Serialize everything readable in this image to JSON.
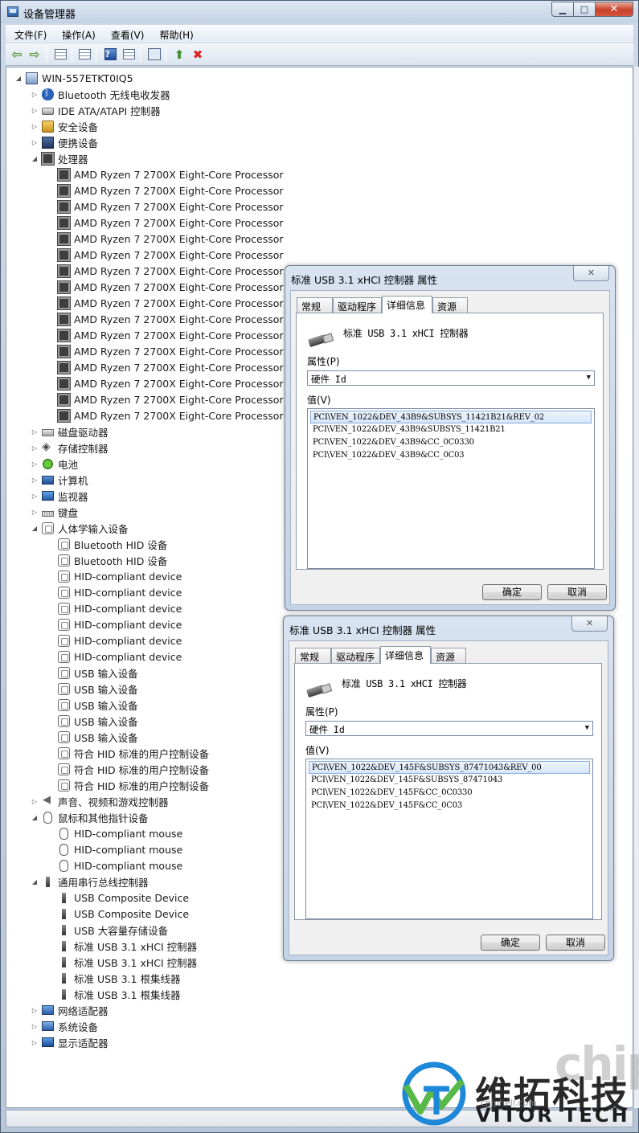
{
  "window": {
    "title": "设备管理器"
  },
  "menu": [
    "文件(F)",
    "操作(A)",
    "查看(V)",
    "帮助(H)"
  ],
  "toolbar": {
    "icons": [
      "back-arrow-icon",
      "forward-arrow-icon",
      "show-hide-tree-icon",
      "properties-icon",
      "help-icon",
      "details-view-icon",
      "scan-hardware-icon",
      "update-driver-icon",
      "uninstall-icon"
    ]
  },
  "tree": {
    "root": "WIN-557ETKT0IQ5",
    "rows": [
      {
        "level": 1,
        "expand": "▷",
        "icon": "bt",
        "label": "Bluetooth 无线电收发器"
      },
      {
        "level": 1,
        "expand": "▷",
        "icon": "drive",
        "label": "IDE ATA/ATAPI 控制器"
      },
      {
        "level": 1,
        "expand": "▷",
        "icon": "key",
        "label": "安全设备"
      },
      {
        "level": 1,
        "expand": "▷",
        "icon": "portable",
        "label": "便携设备"
      },
      {
        "level": 1,
        "expand": "◢",
        "icon": "cpu",
        "label": "处理器"
      },
      {
        "level": 2,
        "expand": "",
        "icon": "cpu",
        "label": "AMD Ryzen 7 2700X Eight-Core Processor"
      },
      {
        "level": 2,
        "expand": "",
        "icon": "cpu",
        "label": "AMD Ryzen 7 2700X Eight-Core Processor"
      },
      {
        "level": 2,
        "expand": "",
        "icon": "cpu",
        "label": "AMD Ryzen 7 2700X Eight-Core Processor"
      },
      {
        "level": 2,
        "expand": "",
        "icon": "cpu",
        "label": "AMD Ryzen 7 2700X Eight-Core Processor"
      },
      {
        "level": 2,
        "expand": "",
        "icon": "cpu",
        "label": "AMD Ryzen 7 2700X Eight-Core Processor"
      },
      {
        "level": 2,
        "expand": "",
        "icon": "cpu",
        "label": "AMD Ryzen 7 2700X Eight-Core Processor"
      },
      {
        "level": 2,
        "expand": "",
        "icon": "cpu",
        "label": "AMD Ryzen 7 2700X Eight-Core Processor"
      },
      {
        "level": 2,
        "expand": "",
        "icon": "cpu",
        "label": "AMD Ryzen 7 2700X Eight-Core Processor"
      },
      {
        "level": 2,
        "expand": "",
        "icon": "cpu",
        "label": "AMD Ryzen 7 2700X Eight-Core Processor"
      },
      {
        "level": 2,
        "expand": "",
        "icon": "cpu",
        "label": "AMD Ryzen 7 2700X Eight-Core Processor"
      },
      {
        "level": 2,
        "expand": "",
        "icon": "cpu",
        "label": "AMD Ryzen 7 2700X Eight-Core Processor"
      },
      {
        "level": 2,
        "expand": "",
        "icon": "cpu",
        "label": "AMD Ryzen 7 2700X Eight-Core Processor"
      },
      {
        "level": 2,
        "expand": "",
        "icon": "cpu",
        "label": "AMD Ryzen 7 2700X Eight-Core Processor"
      },
      {
        "level": 2,
        "expand": "",
        "icon": "cpu",
        "label": "AMD Ryzen 7 2700X Eight-Core Processor"
      },
      {
        "level": 2,
        "expand": "",
        "icon": "cpu",
        "label": "AMD Ryzen 7 2700X Eight-Core Processor"
      },
      {
        "level": 2,
        "expand": "",
        "icon": "cpu",
        "label": "AMD Ryzen 7 2700X Eight-Core Processor"
      },
      {
        "level": 1,
        "expand": "▷",
        "icon": "disk",
        "label": "磁盘驱动器"
      },
      {
        "level": 1,
        "expand": "▷",
        "icon": "storage",
        "label": "存储控制器"
      },
      {
        "level": 1,
        "expand": "▷",
        "icon": "battery",
        "label": "电池"
      },
      {
        "level": 1,
        "expand": "▷",
        "icon": "pc",
        "label": "计算机"
      },
      {
        "level": 1,
        "expand": "▷",
        "icon": "monitor",
        "label": "监视器"
      },
      {
        "level": 1,
        "expand": "▷",
        "icon": "keyboard",
        "label": "键盘"
      },
      {
        "level": 1,
        "expand": "◢",
        "icon": "hid",
        "label": "人体学输入设备"
      },
      {
        "level": 2,
        "expand": "",
        "icon": "hid",
        "label": "Bluetooth HID 设备"
      },
      {
        "level": 2,
        "expand": "",
        "icon": "hid",
        "label": "Bluetooth HID 设备"
      },
      {
        "level": 2,
        "expand": "",
        "icon": "hid",
        "label": "HID-compliant device"
      },
      {
        "level": 2,
        "expand": "",
        "icon": "hid",
        "label": "HID-compliant device"
      },
      {
        "level": 2,
        "expand": "",
        "icon": "hid",
        "label": "HID-compliant device"
      },
      {
        "level": 2,
        "expand": "",
        "icon": "hid",
        "label": "HID-compliant device"
      },
      {
        "level": 2,
        "expand": "",
        "icon": "hid",
        "label": "HID-compliant device"
      },
      {
        "level": 2,
        "expand": "",
        "icon": "hid",
        "label": "HID-compliant device"
      },
      {
        "level": 2,
        "expand": "",
        "icon": "hid",
        "label": "USB 输入设备"
      },
      {
        "level": 2,
        "expand": "",
        "icon": "hid",
        "label": "USB 输入设备"
      },
      {
        "level": 2,
        "expand": "",
        "icon": "hid",
        "label": "USB 输入设备"
      },
      {
        "level": 2,
        "expand": "",
        "icon": "hid",
        "label": "USB 输入设备"
      },
      {
        "level": 2,
        "expand": "",
        "icon": "hid",
        "label": "USB 输入设备"
      },
      {
        "level": 2,
        "expand": "",
        "icon": "hid",
        "label": "符合 HID 标准的用户控制设备"
      },
      {
        "level": 2,
        "expand": "",
        "icon": "hid",
        "label": "符合 HID 标准的用户控制设备"
      },
      {
        "level": 2,
        "expand": "",
        "icon": "hid",
        "label": "符合 HID 标准的用户控制设备"
      },
      {
        "level": 1,
        "expand": "▷",
        "icon": "sound",
        "label": "声音、视频和游戏控制器"
      },
      {
        "level": 1,
        "expand": "◢",
        "icon": "mouse",
        "label": "鼠标和其他指针设备"
      },
      {
        "level": 2,
        "expand": "",
        "icon": "mouse",
        "label": "HID-compliant mouse"
      },
      {
        "level": 2,
        "expand": "",
        "icon": "mouse",
        "label": "HID-compliant mouse"
      },
      {
        "level": 2,
        "expand": "",
        "icon": "mouse",
        "label": "HID-compliant mouse"
      },
      {
        "level": 1,
        "expand": "◢",
        "icon": "usb",
        "label": "通用串行总线控制器"
      },
      {
        "level": 2,
        "expand": "",
        "icon": "usb",
        "label": "USB Composite Device"
      },
      {
        "level": 2,
        "expand": "",
        "icon": "usb",
        "label": "USB Composite Device"
      },
      {
        "level": 2,
        "expand": "",
        "icon": "usb",
        "label": "USB 大容量存储设备"
      },
      {
        "level": 2,
        "expand": "",
        "icon": "usb",
        "label": "标准 USB 3.1 xHCI 控制器"
      },
      {
        "level": 2,
        "expand": "",
        "icon": "usb",
        "label": "标准 USB 3.1 xHCI 控制器"
      },
      {
        "level": 2,
        "expand": "",
        "icon": "usb",
        "label": "标准 USB 3.1 根集线器"
      },
      {
        "level": 2,
        "expand": "",
        "icon": "usb",
        "label": "标准 USB 3.1 根集线器"
      },
      {
        "level": 1,
        "expand": "▷",
        "icon": "net",
        "label": "网络适配器"
      },
      {
        "level": 1,
        "expand": "▷",
        "icon": "sys",
        "label": "系统设备"
      },
      {
        "level": 1,
        "expand": "▷",
        "icon": "display",
        "label": "显示适配器"
      }
    ]
  },
  "dialogs": [
    {
      "title": "标准 USB 3.1 xHCI 控制器 属性",
      "close": "✕",
      "tabs": [
        "常规",
        "驱动程序",
        "详细信息",
        "资源"
      ],
      "active_tab": 2,
      "device_name": "标准 USB 3.1 xHCI 控制器",
      "property_label": "属性(P)",
      "property_value": "硬件 Id",
      "value_label": "值(V)",
      "values": [
        "PCI\\VEN_1022&DEV_43B9&SUBSYS_11421B21&REV_02",
        "PCI\\VEN_1022&DEV_43B9&SUBSYS_11421B21",
        "PCI\\VEN_1022&DEV_43B9&CC_0C0330",
        "PCI\\VEN_1022&DEV_43B9&CC_0C03"
      ],
      "ok": "确定",
      "cancel": "取消"
    },
    {
      "title": "标准 USB 3.1 xHCI 控制器 属性",
      "close": "✕",
      "tabs": [
        "常规",
        "驱动程序",
        "详细信息",
        "资源"
      ],
      "active_tab": 2,
      "device_name": "标准 USB 3.1 xHCI 控制器",
      "property_label": "属性(P)",
      "property_value": "硬件 Id",
      "value_label": "值(V)",
      "values": [
        "PCI\\VEN_1022&DEV_145F&SUBSYS_87471043&REV_00",
        "PCI\\VEN_1022&DEV_145F&SUBSYS_87471043",
        "PCI\\VEN_1022&DEV_145F&CC_0C0330",
        "PCI\\VEN_1022&DEV_145F&CC_0C03"
      ],
      "ok": "确定",
      "cancel": "取消"
    }
  ],
  "watermark": {
    "brand_cn": "维拓科技",
    "brand_en": "VITOR TECH",
    "chip": "chip",
    "site": "chiphell.com"
  }
}
